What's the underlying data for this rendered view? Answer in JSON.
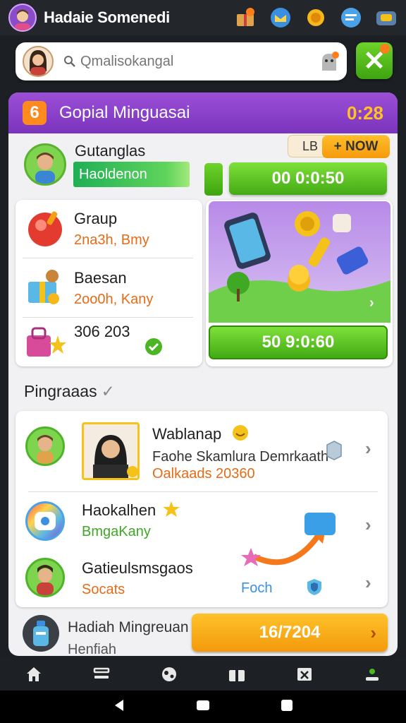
{
  "topbar": {
    "title": "Hadaie Somenedi",
    "icons": [
      "avatar-icon",
      "gift-box-icon",
      "mail-icon",
      "coin-icon",
      "message-icon",
      "chest-icon"
    ]
  },
  "search": {
    "placeholder": "Qmalisokangal",
    "close_label": "✕"
  },
  "card": {
    "title": "Gopial Minguasai",
    "value": "0:28",
    "promo": {
      "title": "Gutanglas",
      "bar_label": "Haoldenon",
      "now_label_1": "LB",
      "now_label_2": "+ NOW",
      "timer1": "00 0:0:50"
    },
    "left_list": [
      {
        "title": "Graup",
        "sub": "2na3h, Bmy"
      },
      {
        "title": "Baesan",
        "sub": "2oo0h, Kany"
      },
      {
        "title": "306 203",
        "sub": ""
      }
    ],
    "timer2": "50 9:0:60"
  },
  "section2": {
    "title": "Pingraaas",
    "rows": [
      {
        "title": "Wablanap",
        "desc": "Faohe Skamlura Demrkaath",
        "sub": "Oalkaads 20360"
      },
      {
        "title": "Haokalhen",
        "desc": "",
        "sub": "BmgaKany"
      },
      {
        "title": "Gatieulsmsgaos",
        "desc": "",
        "sub": "Socats",
        "extra": "Foch"
      }
    ]
  },
  "bottom": {
    "title": "Hadiah Mingreuan",
    "sub": "Henfiah",
    "button": "16/7204"
  },
  "colors": {
    "header_purple": "#8a42c9",
    "green": "#4cb524",
    "orange": "#f5a012"
  }
}
